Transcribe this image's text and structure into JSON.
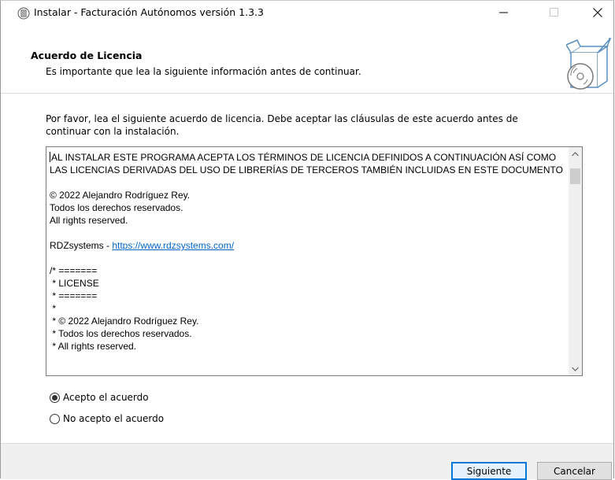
{
  "window": {
    "title": "Instalar - Facturación Autónomos versión 1.3.3",
    "controls": {
      "minimize": "—",
      "maximize": "☐",
      "close": "✕"
    }
  },
  "header": {
    "title": "Acuerdo de Licencia",
    "subtitle": "Es importante que lea la siguiente información antes de continuar."
  },
  "intro": "Por favor, lea el siguiente acuerdo de licencia. Debe aceptar las cláusulas de este acuerdo antes de continuar con la instalación.",
  "license": {
    "text_before_link": "AL INSTALAR ESTE PROGRAMA ACEPTA LOS TÉRMINOS DE LICENCIA DEFINIDOS A CONTINUACIÓN ASÍ COMO LAS LICENCIAS DERIVADAS DEL USO DE LIBRERÍAS DE TERCEROS TAMBIÉN INCLUIDAS EN ESTE DOCUMENTO\n\n© 2022 Alejandro Rodríguez Rey.\nTodos los derechos reservados.\nAll rights reserved.\n\nRDZsystems - ",
    "link": "https://www.rdzsystems.com/",
    "text_after_link": "\n\n/* =======\n * LICENSE\n * =======\n *\n * © 2022 Alejandro Rodríguez Rey.\n * Todos los derechos reservados.\n * All rights reserved."
  },
  "options": {
    "accept": "Acepto el acuerdo",
    "decline": "No acepto el acuerdo",
    "selected": "accept"
  },
  "buttons": {
    "next": "Siguiente",
    "cancel": "Cancelar"
  },
  "colors": {
    "accent": "#0078d7",
    "link": "#0066cc"
  }
}
